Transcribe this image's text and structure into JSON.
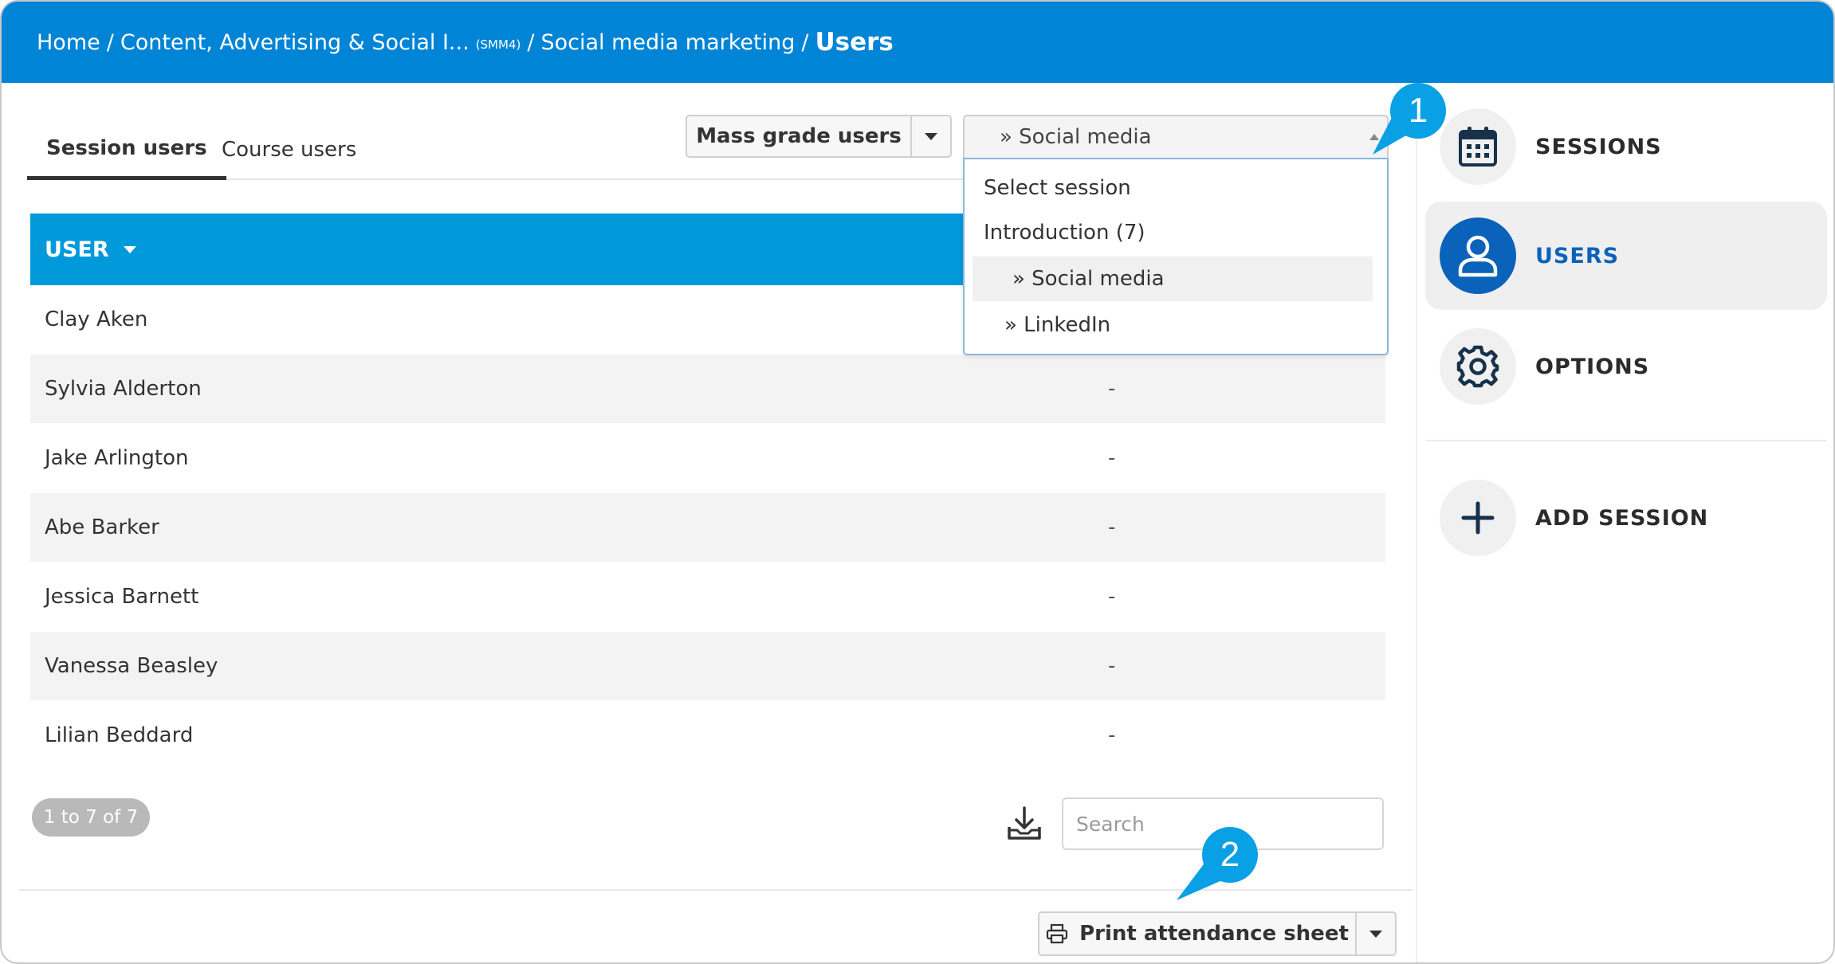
{
  "breadcrumb": {
    "home": "Home",
    "category": "Content, Advertising & Social I...",
    "category_code": "(SMM4)",
    "course": "Social media marketing",
    "current": "Users",
    "separator": "/"
  },
  "tabs": [
    {
      "label": "Session users",
      "active": true
    },
    {
      "label": "Course users",
      "active": false
    }
  ],
  "mass_grade": {
    "label": "Mass grade users"
  },
  "session_select": {
    "value": "» Social media",
    "options": [
      "Select session",
      "Introduction (7)",
      "» Social media",
      "» LinkedIn"
    ]
  },
  "table": {
    "column_header": "USER",
    "rows": [
      {
        "name": "Clay Aken",
        "value": ""
      },
      {
        "name": "Sylvia Alderton",
        "value": "-"
      },
      {
        "name": "Jake Arlington",
        "value": "-"
      },
      {
        "name": "Abe Barker",
        "value": "-"
      },
      {
        "name": "Jessica Barnett",
        "value": "-"
      },
      {
        "name": "Vanessa Beasley",
        "value": "-"
      },
      {
        "name": "Lilian Beddard",
        "value": "-"
      }
    ]
  },
  "pager": {
    "label": "1 to 7 of 7"
  },
  "search": {
    "placeholder": "Search"
  },
  "print_button": {
    "label": "Print attendance sheet"
  },
  "sidebar": {
    "items": [
      {
        "label": "SESSIONS",
        "icon": "calendar-icon",
        "active": false
      },
      {
        "label": "USERS",
        "icon": "user-icon",
        "active": true
      },
      {
        "label": "OPTIONS",
        "icon": "gear-icon",
        "active": false
      },
      {
        "label": "ADD SESSION",
        "icon": "plus-icon",
        "active": false
      }
    ]
  },
  "callouts": [
    "1",
    "2"
  ],
  "colors": {
    "header_bg": "#0084d6",
    "table_header_bg": "#0099da",
    "active_nav": "#0a62ba",
    "callout": "#0aa0e6"
  }
}
